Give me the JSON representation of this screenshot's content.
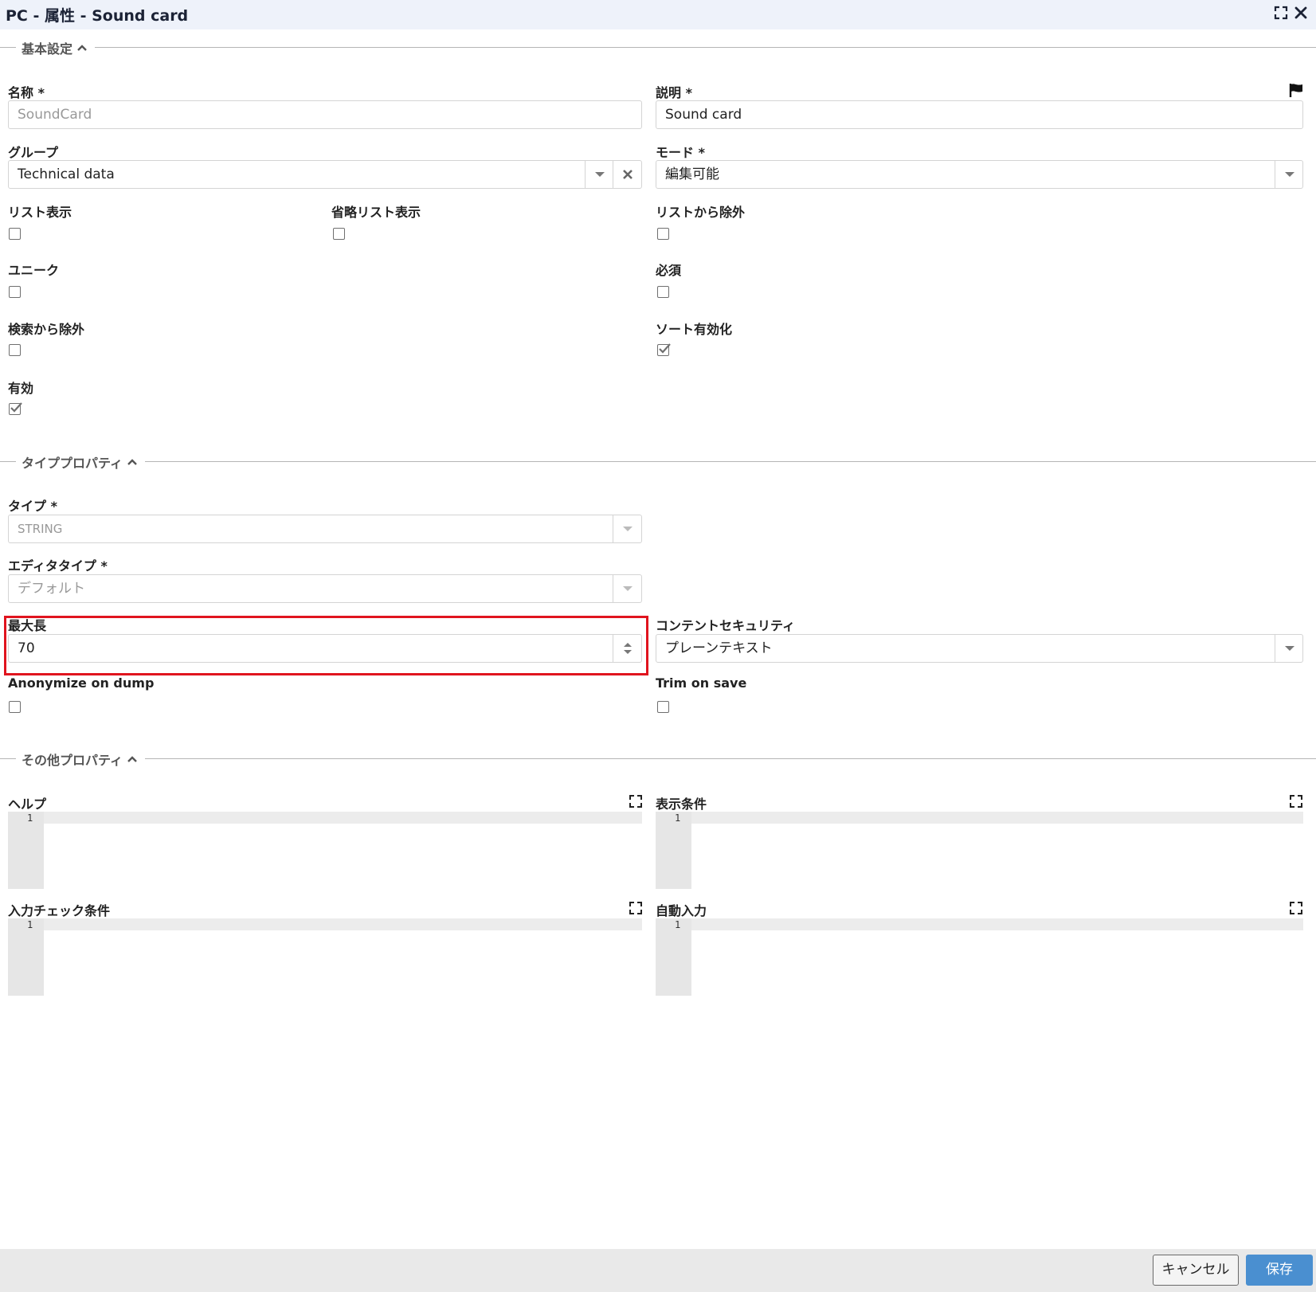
{
  "window": {
    "title": "PC - 属性 - Sound card"
  },
  "sections": {
    "basic": "基本設定",
    "type_props": "タイププロパティ",
    "other_props": "その他プロパティ"
  },
  "basic": {
    "name_label": "名称 *",
    "name_value": "SoundCard",
    "desc_label": "説明 *",
    "desc_value": "Sound card",
    "group_label": "グループ",
    "group_value": "Technical data",
    "mode_label": "モード *",
    "mode_value": "編集可能",
    "list_display_label": "リスト表示",
    "list_display_checked": false,
    "short_list_label": "省略リスト表示",
    "short_list_checked": false,
    "exclude_list_label": "リストから除外",
    "exclude_list_checked": false,
    "unique_label": "ユニーク",
    "unique_checked": false,
    "required_label": "必須",
    "required_checked": false,
    "exclude_search_label": "検索から除外",
    "exclude_search_checked": false,
    "sort_enabled_label": "ソート有効化",
    "sort_enabled_checked": true,
    "enabled_label": "有効",
    "enabled_checked": true
  },
  "type_props": {
    "type_label": "タイプ *",
    "type_value": "STRING",
    "editor_type_label": "エディタタイプ *",
    "editor_type_value": "デフォルト",
    "max_length_label": "最大長",
    "max_length_value": "70",
    "content_security_label": "コンテントセキュリティ",
    "content_security_value": "プレーンテキスト",
    "anonymize_label": "Anonymize on dump",
    "anonymize_checked": false,
    "trim_label": "Trim on save",
    "trim_checked": false
  },
  "other_props": {
    "help_label": "ヘルプ",
    "display_cond_label": "表示条件",
    "input_check_label": "入力チェック条件",
    "auto_input_label": "自動入力",
    "line_number": "1"
  },
  "footer": {
    "cancel_label": "キャンセル",
    "save_label": "保存"
  },
  "colors": {
    "save_button": "#4a8fd0",
    "highlight_border": "#e0141e",
    "titlebar": "#eef2fa"
  }
}
